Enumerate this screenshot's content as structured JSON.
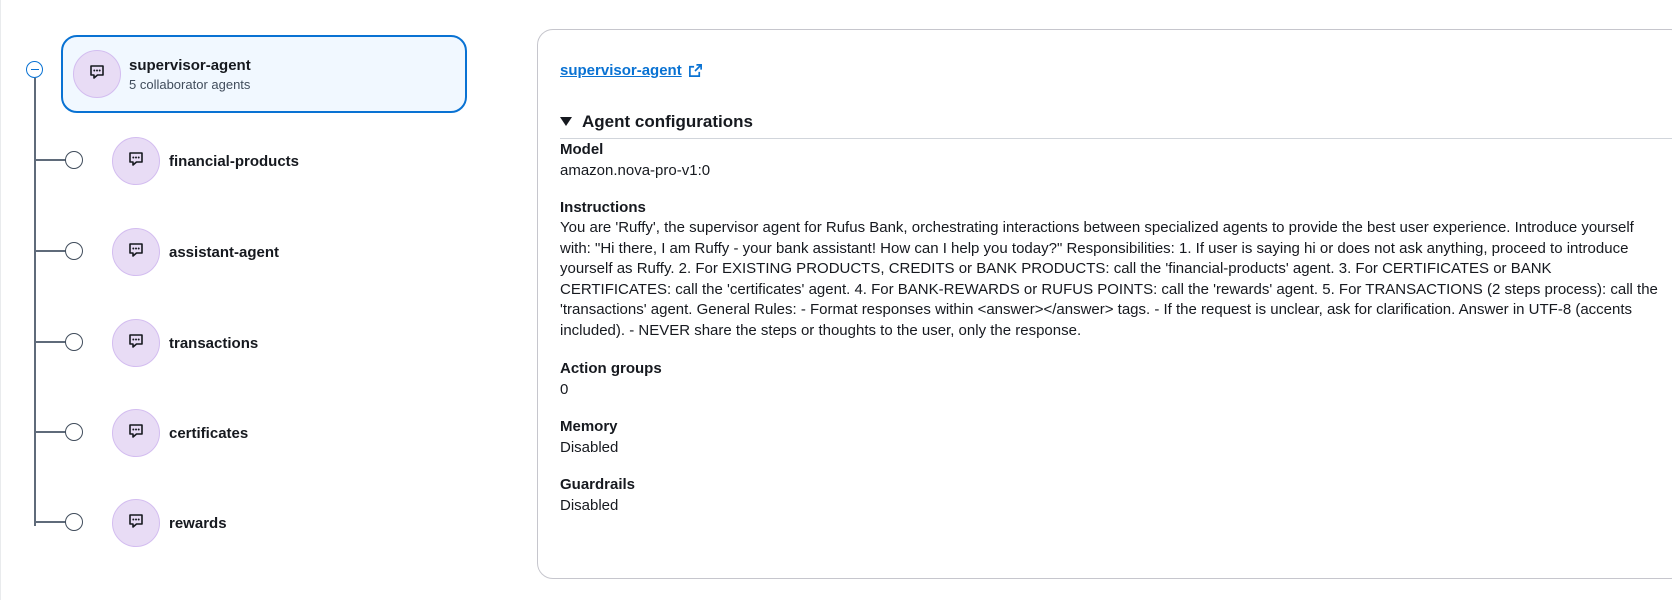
{
  "tree": {
    "root": {
      "name": "supervisor-agent",
      "subtitle": "5 collaborator agents",
      "icon": "agent-chat-icon"
    },
    "children": [
      {
        "name": "financial-products"
      },
      {
        "name": "assistant-agent"
      },
      {
        "name": "transactions"
      },
      {
        "name": "certificates"
      },
      {
        "name": "rewards"
      }
    ]
  },
  "detail": {
    "link_label": "supervisor-agent",
    "section_title": "Agent configurations",
    "fields": {
      "model": {
        "label": "Model",
        "value": "amazon.nova-pro-v1:0"
      },
      "instructions": {
        "label": "Instructions",
        "value": "You are 'Ruffy', the supervisor agent for Rufus Bank, orchestrating interactions between specialized agents to provide the best user experience. Introduce yourself with: \"Hi there, I am Ruffy - your bank assistant! How can I help you today?\" Responsibilities: 1. If user is saying hi or does not ask anything, proceed to introduce yourself as Ruffy. 2. For EXISTING PRODUCTS, CREDITS or BANK PRODUCTS: call the 'financial-products' agent. 3. For CERTIFICATES or BANK CERTIFICATES: call the 'certificates' agent. 4. For BANK-REWARDS or RUFUS POINTS: call the 'rewards' agent. 5. For TRANSACTIONS (2 steps process): call the 'transactions' agent. General Rules: - Format responses within <answer></answer> tags. - If the request is unclear, ask for clarification. Answer in UTF-8 (accents included). - NEVER share the steps or thoughts to the user, only the response."
      },
      "action_groups": {
        "label": "Action groups",
        "value": "0"
      },
      "memory": {
        "label": "Memory",
        "value": "Disabled"
      },
      "guardrails": {
        "label": "Guardrails",
        "value": "Disabled"
      }
    }
  },
  "colors": {
    "accent": "#0972d3",
    "root_card_bg": "#f1f8ff",
    "avatar_bg": "#e8dcf5",
    "tree_line": "#5f6b7a"
  }
}
